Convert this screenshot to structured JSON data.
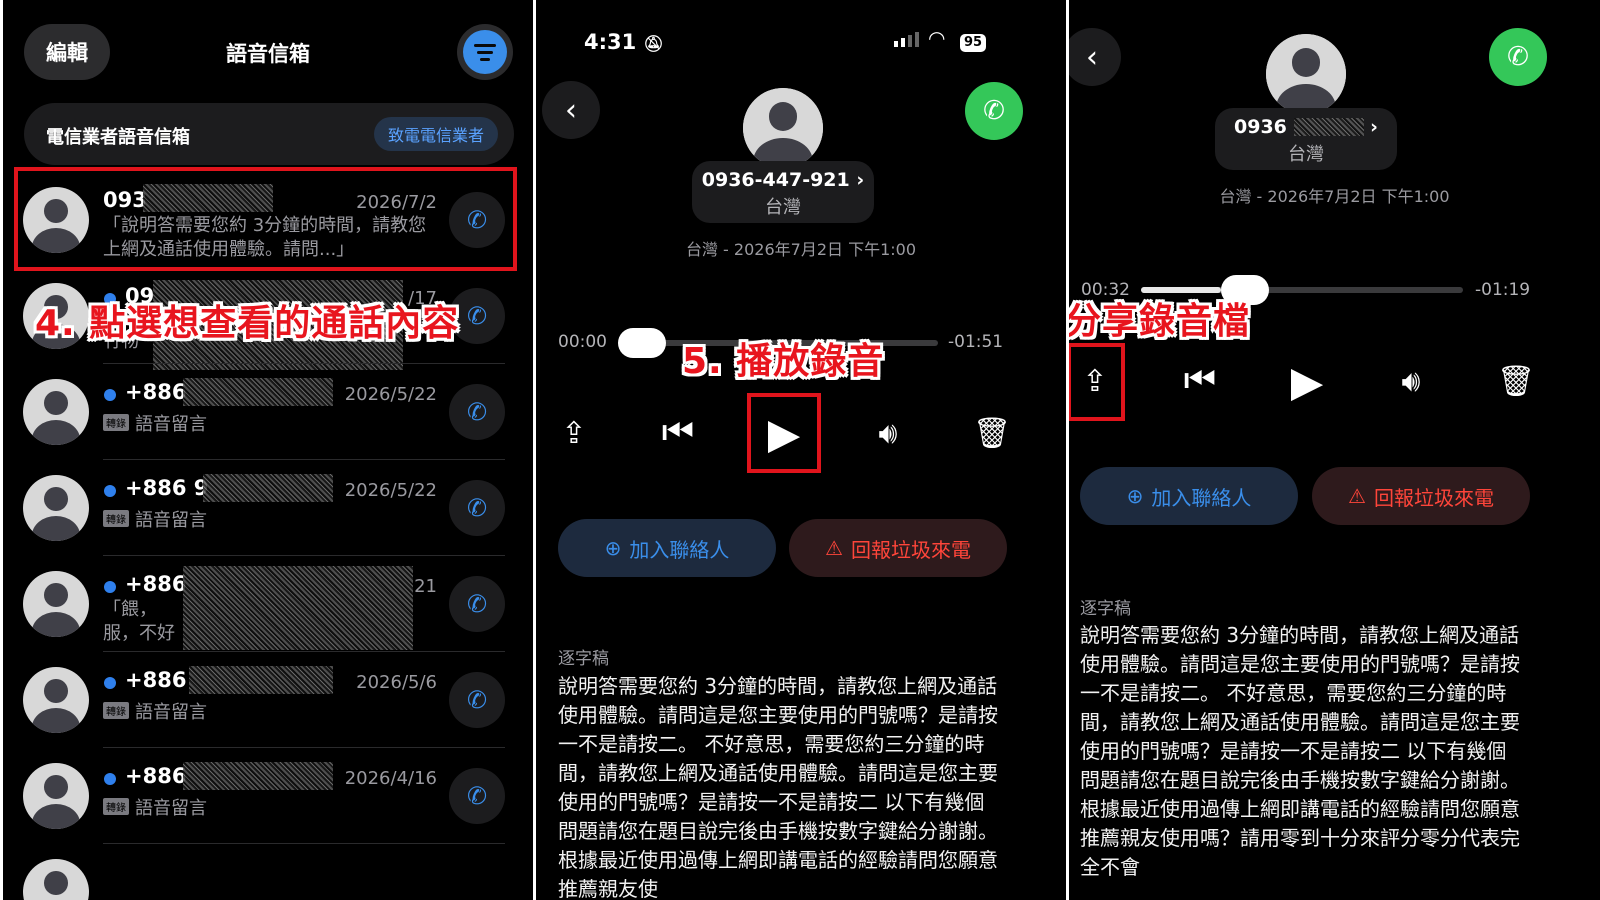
{
  "colors": {
    "background": "#000000",
    "accent_blue": "#3a8eea",
    "green": "#34c759",
    "annotation_red": "#e8151e"
  },
  "voicemail_list": {
    "edit_label": "編輯",
    "title": "語音信箱",
    "filter_icon": "filter-icon",
    "carrier": {
      "label": "電信業者語音信箱",
      "action": "致電電信業者"
    },
    "rows": [
      {
        "number": "093",
        "date": "2026/7/2",
        "message": "「說明答需要您約 3分鐘的時間，請教您上網及通話使用體驗。請問...」",
        "unread": false
      },
      {
        "number": "09",
        "date": "/17",
        "message": "竹物",
        "unread": false
      },
      {
        "number": "+886",
        "date": "2026/5/22",
        "sub": "語音留言",
        "unread": true
      },
      {
        "number": "+886 9",
        "date": "2026/5/22",
        "sub": "語音留言",
        "unread": true
      },
      {
        "number": "+886",
        "date": "21",
        "message": "「餵，\n服，不好",
        "unread": true
      },
      {
        "number": "+886",
        "date": "2026/5/6",
        "sub": "語音留言",
        "unread": true
      },
      {
        "number": "+886",
        "date": "2026/4/16",
        "sub": "語音留言",
        "unread": true
      }
    ],
    "tag_label": "轉錄",
    "annotation": "4. 點選想查看的通話內容"
  },
  "detail_playing": {
    "status_time": "4:31",
    "battery": "95",
    "number": "0936-447-921",
    "country": "台灣",
    "meta": "台灣 - 2026年7月2日 下午1:00",
    "elapsed": "00:00",
    "remaining": "-01:51",
    "progress": 0.0,
    "annotation": "5. 播放錄音",
    "add_contact": "加入聯絡人",
    "report_spam": "回報垃圾來電",
    "transcript_heading": "逐字稿",
    "transcript": "說明答需要您約 3分鐘的時間，請教您上網及通話使用體驗。請問這是您主要使用的門號嗎？是請按一不是請按二。 不好意思，需要您約三分鐘的時間，請教您上網及通話使用體驗。請問這是您主要使用的門號嗎？是請按一不是請按二 以下有幾個問題請您在題目說完後由手機按數字鍵給分謝謝。根據最近使用過傳上網即講電話的經驗請問您願意推薦親友使"
  },
  "detail_share": {
    "number": "0936",
    "country": "台灣",
    "meta": "台灣 - 2026年7月2日 下午1:00",
    "elapsed": "00:32",
    "remaining": "-01:19",
    "progress": 0.21,
    "annotation": "分享錄音檔",
    "add_contact": "加入聯絡人",
    "report_spam": "回報垃圾來電",
    "transcript_heading": "逐字稿",
    "transcript": "說明答需要您約 3分鐘的時間，請教您上網及通話使用體驗。請問這是您主要使用的門號嗎？是請按一不是請按二。 不好意思，需要您約三分鐘的時間，請教您上網及通話使用體驗。請問這是您主要使用的門號嗎？是請按一不是請按二 以下有幾個問題請您在題目說完後由手機按數字鍵給分謝謝。根據最近使用過傳上網即講電話的經驗請問您願意推薦親友使用嗎？請用零到十分來評分零分代表完全不會"
  }
}
